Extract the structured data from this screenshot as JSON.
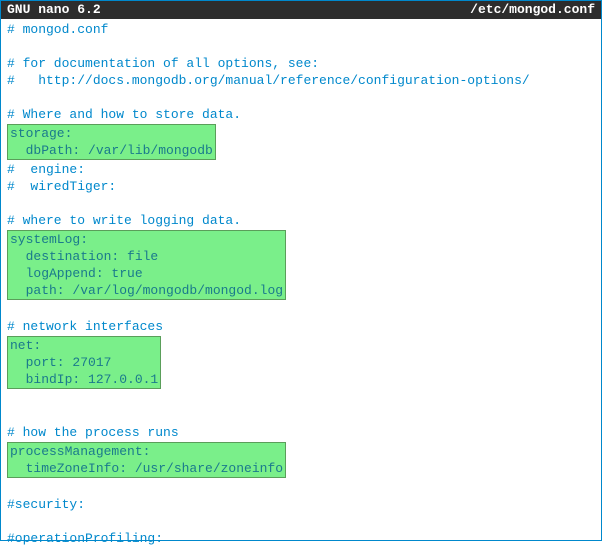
{
  "titlebar": {
    "left": "  GNU nano 6.2",
    "right": "/etc/mongod.conf  "
  },
  "lines": {
    "l1": "# mongod.conf",
    "l2": "# for documentation of all options, see:",
    "l3": "#   http://docs.mongodb.org/manual/reference/configuration-options/",
    "l4": "# Where and how to store data.",
    "l5a": "storage:",
    "l5b": "  dbPath: /var/lib/mongodb",
    "l6": "#  engine:",
    "l7": "#  wiredTiger:",
    "l8": "# where to write logging data.",
    "l9a": "systemLog:",
    "l9b": "  destination: file",
    "l9c": "  logAppend: true",
    "l9d": "  path: /var/log/mongodb/mongod.log",
    "l10": "# network interfaces",
    "l11a": "net:",
    "l11b": "  port: 27017",
    "l11c": "  bindIp: 127.0.0.1",
    "l12": "# how the process runs",
    "l13a": "processManagement:",
    "l13b": "  timeZoneInfo: /usr/share/zoneinfo",
    "l14": "#security:",
    "l15": "#operationProfiling:"
  }
}
